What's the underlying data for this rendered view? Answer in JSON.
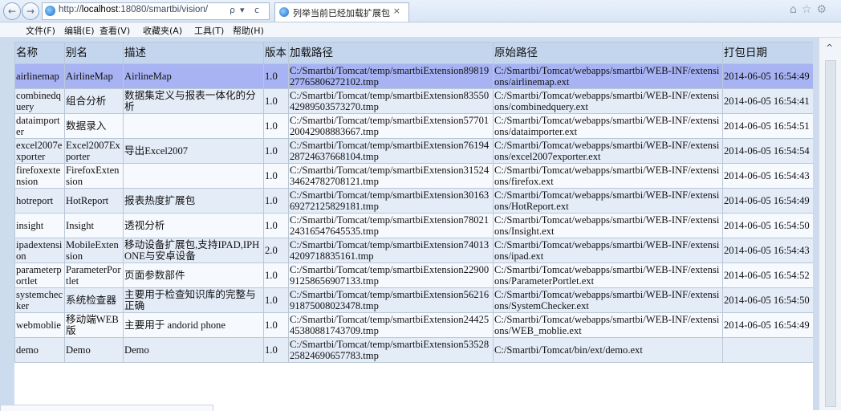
{
  "browser": {
    "back_icon": "back-arrow-icon",
    "forward_icon": "forward-arrow-icon",
    "url_prefix": "http://",
    "url_host": "localhost",
    "url_rest": ":18080/smartbi/vision/",
    "search_glyph": "ρ",
    "dropdown_glyph": "▾",
    "refresh_glyph": "c",
    "tab_title": "列举当前已经加载扩展包",
    "tab_close": "×",
    "toolbar_icons": [
      "home-icon",
      "star-icon",
      "gear-icon"
    ]
  },
  "menubar": {
    "items": [
      "文件(F)",
      "编辑(E)",
      "查看(V)",
      "收藏夹(A)",
      "工具(T)",
      "帮助(H)"
    ]
  },
  "table": {
    "headers": [
      "名称",
      "别名",
      "描述",
      "版本",
      "加载路径",
      "原始路径",
      "打包日期"
    ],
    "rows": [
      [
        "airlinemap",
        "AirlineMap",
        "AirlineMap",
        "1.0",
        "C:/Smartbi/Tomcat/temp/smartbiExtension8981927765806272102.tmp",
        "C:/Smartbi/Tomcat/webapps/smartbi/WEB-INF/extensions/airlinemap.ext",
        "2014-06-05 16:54:49"
      ],
      [
        "combinedquery",
        "组合分析",
        "数据集定义与报表一体化的分析",
        "1.0",
        "C:/Smartbi/Tomcat/temp/smartbiExtension8355042989503573270.tmp",
        "C:/Smartbi/Tomcat/webapps/smartbi/WEB-INF/extensions/combinedquery.ext",
        "2014-06-05 16:54:41"
      ],
      [
        "dataimporter",
        "数据录入",
        "",
        "1.0",
        "C:/Smartbi/Tomcat/temp/smartbiExtension5770120042908883667.tmp",
        "C:/Smartbi/Tomcat/webapps/smartbi/WEB-INF/extensions/dataimporter.ext",
        "2014-06-05 16:54:51"
      ],
      [
        "excel2007exporter",
        "Excel2007Exporter",
        "导出Excel2007",
        "1.0",
        "C:/Smartbi/Tomcat/temp/smartbiExtension7619428724637668104.tmp",
        "C:/Smartbi/Tomcat/webapps/smartbi/WEB-INF/extensions/excel2007exporter.ext",
        "2014-06-05 16:54:54"
      ],
      [
        "firefoxextension",
        "FirefoxExtension",
        "",
        "1.0",
        "C:/Smartbi/Tomcat/temp/smartbiExtension3152434624782708121.tmp",
        "C:/Smartbi/Tomcat/webapps/smartbi/WEB-INF/extensions/firefox.ext",
        "2014-06-05 16:54:43"
      ],
      [
        "hotreport",
        "HotReport",
        "报表热度扩展包",
        "1.0",
        "C:/Smartbi/Tomcat/temp/smartbiExtension3016369272125829181.tmp",
        "C:/Smartbi/Tomcat/webapps/smartbi/WEB-INF/extensions/HotReport.ext",
        "2014-06-05 16:54:49"
      ],
      [
        "insight",
        "Insight",
        "透视分析",
        "1.0",
        "C:/Smartbi/Tomcat/temp/smartbiExtension7802124316547645535.tmp",
        "C:/Smartbi/Tomcat/webapps/smartbi/WEB-INF/extensions/Insight.ext",
        "2014-06-05 16:54:50"
      ],
      [
        "ipadextension",
        "MobileExtension",
        "移动设备扩展包,支持IPAD,IPHONE与安卓设备",
        "2.0",
        "C:/Smartbi/Tomcat/temp/smartbiExtension740134209718835161.tmp",
        "C:/Smartbi/Tomcat/webapps/smartbi/WEB-INF/extensions/ipad.ext",
        "2014-06-05 16:54:43"
      ],
      [
        "parameterportlet",
        "ParameterPortlet",
        "页面参数部件",
        "1.0",
        "C:/Smartbi/Tomcat/temp/smartbiExtension2290091258656907133.tmp",
        "C:/Smartbi/Tomcat/webapps/smartbi/WEB-INF/extensions/ParameterPortlet.ext",
        "2014-06-05 16:54:52"
      ],
      [
        "systemchecker",
        "系统检查器",
        "主要用于检查知识库的完整与正确",
        "1.0",
        "C:/Smartbi/Tomcat/temp/smartbiExtension5621691875008023478.tmp",
        "C:/Smartbi/Tomcat/webapps/smartbi/WEB-INF/extensions/SystemChecker.ext",
        "2014-06-05 16:54:50"
      ],
      [
        "webmoblie",
        "移动端WEB版",
        "主要用于 andorid phone",
        "1.0",
        "C:/Smartbi/Tomcat/temp/smartbiExtension2442545380881743709.tmp",
        "C:/Smartbi/Tomcat/webapps/smartbi/WEB-INF/extensions/WEB_moblie.ext",
        "2014-06-05 16:54:49"
      ],
      [
        "demo",
        "Demo",
        "Demo",
        "1.0",
        "C:/Smartbi/Tomcat/temp/smartbiExtension5352825824690657783.tmp",
        "C:/Smartbi/Tomcat/bin/ext/demo.ext",
        ""
      ]
    ],
    "selected_row": 0
  },
  "scrollbar": {
    "up_glyph": "^"
  },
  "colors": {
    "header_bg": "#c4d6ee",
    "row_even": "#f6f9fd",
    "row_odd": "#e4ecf8",
    "selected_row": "#a7b3f3",
    "page_bg": "#ccdcee"
  }
}
